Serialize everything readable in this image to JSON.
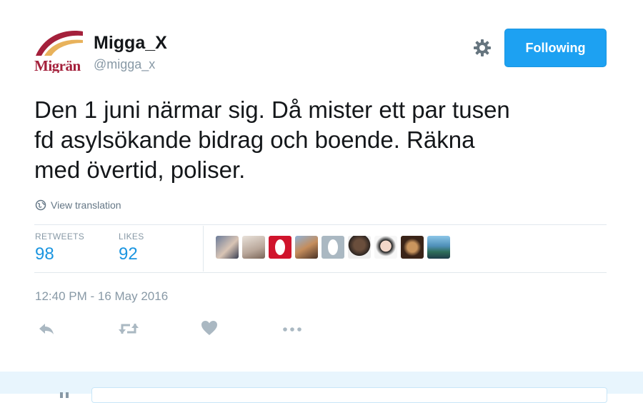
{
  "user": {
    "display_name": "Migga_X",
    "handle": "@migga_x",
    "avatar_brand_text": "Migrän"
  },
  "header": {
    "settings_icon": "gear-icon",
    "follow_label": "Following"
  },
  "tweet": {
    "lines": [
      "Den 1 juni närmar sig. Då mister ett par tusen",
      "fd asylsökande bidrag och boende. Räkna",
      "med övertid, poliser."
    ],
    "translate_label": "View translation",
    "timestamp": "12:40 PM - 16 May 2016"
  },
  "stats": {
    "retweets_label": "RETWEETS",
    "retweets_value": "98",
    "likes_label": "LIKES",
    "likes_value": "92"
  },
  "actions": [
    "reply-icon",
    "retweet-icon",
    "like-icon",
    "more-icon"
  ],
  "colors": {
    "accent": "#1da1f2",
    "link": "#1b95e0",
    "brand": "#a4203b",
    "muted": "#8899a6"
  }
}
